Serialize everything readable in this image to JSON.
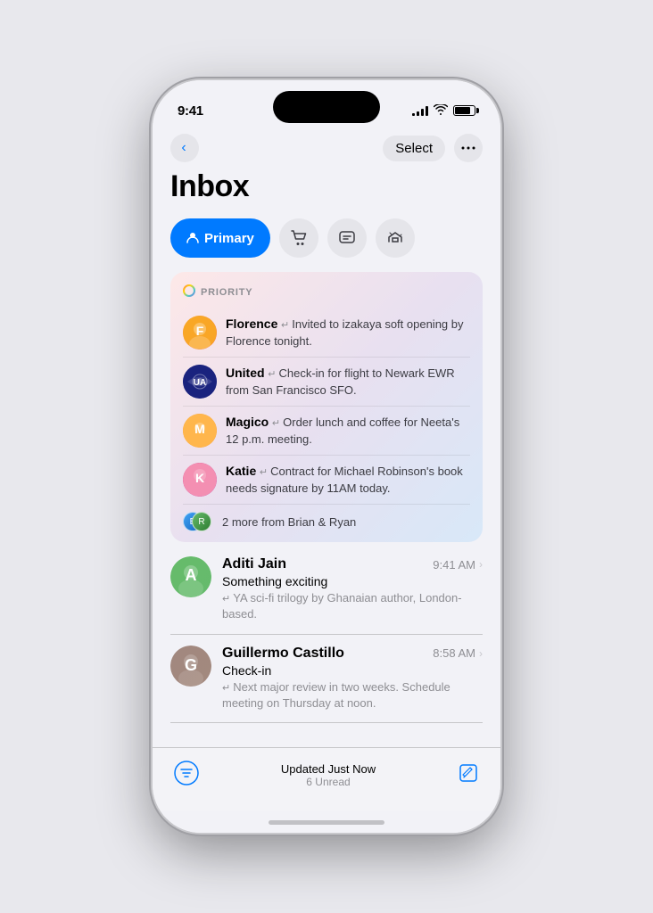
{
  "status": {
    "time": "9:41",
    "signal_bars": [
      3,
      6,
      9,
      12
    ],
    "battery_level": "80%"
  },
  "nav": {
    "select_label": "Select",
    "more_icon": "•••"
  },
  "inbox": {
    "title": "Inbox",
    "tabs": [
      {
        "id": "primary",
        "label": "Primary",
        "icon": "👤",
        "active": true
      },
      {
        "id": "shopping",
        "label": "Shopping",
        "icon": "🛒",
        "active": false
      },
      {
        "id": "messages",
        "label": "Messages",
        "icon": "💬",
        "active": false
      },
      {
        "id": "promos",
        "label": "Promos",
        "icon": "📢",
        "active": false
      }
    ],
    "priority": {
      "label": "PRIORITY",
      "items": [
        {
          "sender": "Florence",
          "message": "Invited to izakaya soft opening by Florence tonight.",
          "avatar_initials": "F",
          "avatar_class": "av-florence"
        },
        {
          "sender": "United",
          "message": "Check-in for flight to Newark EWR from San Francisco SFO.",
          "avatar_initials": "U",
          "avatar_class": "av-united"
        },
        {
          "sender": "Magico",
          "message": "Order lunch and coffee for Neeta's 12 p.m. meeting.",
          "avatar_initials": "M",
          "avatar_class": "av-magico"
        },
        {
          "sender": "Katie",
          "message": "Contract for Michael Robinson's book needs signature by 11AM today.",
          "avatar_initials": "K",
          "avatar_class": "av-katie"
        }
      ],
      "more_text": "2 more from Brian & Ryan"
    },
    "mail_items": [
      {
        "sender": "Aditi Jain",
        "time": "9:41 AM",
        "subject": "Something exciting",
        "preview": "YA sci-fi trilogy by Ghanaian author, London-based.",
        "avatar_initials": "A",
        "avatar_class": "av-aditi"
      },
      {
        "sender": "Guillermo Castillo",
        "time": "8:58 AM",
        "subject": "Check-in",
        "preview": "Next major review in two weeks. Schedule meeting on Thursday at noon.",
        "avatar_initials": "G",
        "avatar_class": "av-guillermo"
      }
    ]
  },
  "toolbar": {
    "updated_text": "Updated Just Now",
    "unread_text": "6 Unread"
  }
}
